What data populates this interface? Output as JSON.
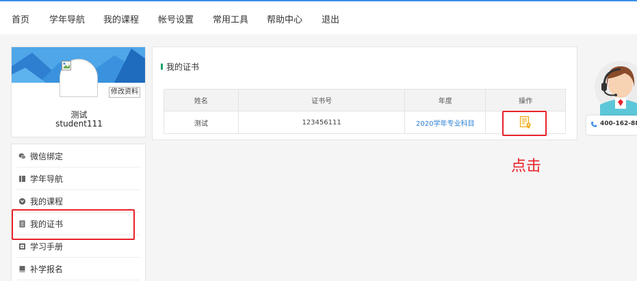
{
  "nav": [
    "首页",
    "学年导航",
    "我的课程",
    "帐号设置",
    "常用工具",
    "帮助中心",
    "退出"
  ],
  "profile": {
    "edit_label": "修改资料",
    "name": "测试",
    "username": "student111"
  },
  "sidebar": {
    "items": [
      {
        "label": "微信绑定",
        "icon": "wechat-icon"
      },
      {
        "label": "学年导航",
        "icon": "book-icon"
      },
      {
        "label": "我的课程",
        "icon": "course-icon"
      },
      {
        "label": "我的证书",
        "icon": "certificate-list-icon"
      },
      {
        "label": "学习手册",
        "icon": "handbook-icon"
      },
      {
        "label": "补学报名",
        "icon": "register-icon"
      }
    ]
  },
  "certificates": {
    "title": "我的证书",
    "columns": [
      "姓名",
      "证书号",
      "年度",
      "操作"
    ],
    "rows": [
      {
        "name": "测试",
        "number": "123456111",
        "year": "2020学年专业科目",
        "action_icon": "certificate-view-icon"
      }
    ]
  },
  "annotation": {
    "hint": "点击",
    "color": "#e8222a"
  },
  "helper": {
    "phone": "400-162-88"
  },
  "colors": {
    "accent_green": "#1aa36a",
    "link_blue": "#2a7fd4",
    "banner_blue": "#3a8ee6"
  }
}
